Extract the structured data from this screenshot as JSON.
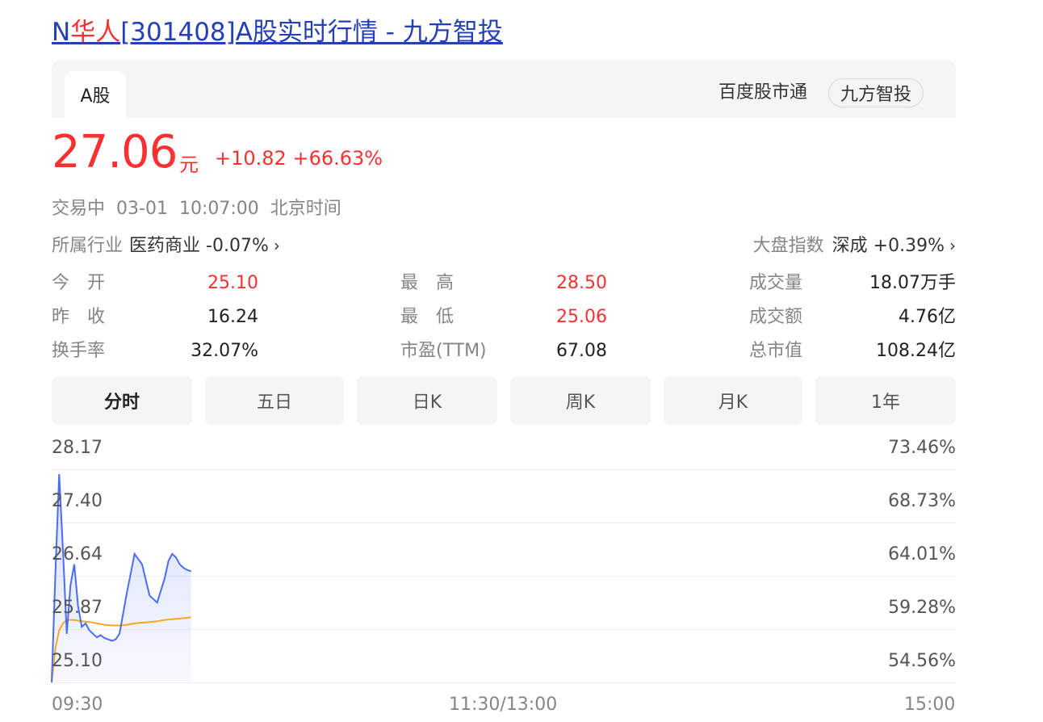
{
  "title": {
    "prefix": "N",
    "highlight": "华人",
    "suffix": "[301408]A股实时行情 - 九方智投"
  },
  "card": {
    "tab_label": "A股",
    "source_label": "百度股市通",
    "source_pill": "九方智投"
  },
  "quote": {
    "price": "27.06",
    "unit": "元",
    "change": "+10.82",
    "change_pct": "+66.63%",
    "status": "交易中",
    "date": "03-01",
    "time": "10:07:00",
    "timezone": "北京时间"
  },
  "industry": {
    "label": "所属行业",
    "name": "医药商业",
    "change": "-0.07%"
  },
  "market_index": {
    "label": "大盘指数",
    "name": "深成",
    "change": "+0.39%"
  },
  "stats": [
    {
      "label": "今　开",
      "value": "25.10",
      "color": "#f73131"
    },
    {
      "label": "最　高",
      "value": "28.50",
      "color": "#f73131"
    },
    {
      "label": "成交量",
      "value": "18.07万手",
      "color": "#222222"
    },
    {
      "label": "昨　收",
      "value": "16.24",
      "color": "#222222"
    },
    {
      "label": "最　低",
      "value": "25.06",
      "color": "#f73131"
    },
    {
      "label": "成交额",
      "value": "4.76亿",
      "color": "#222222"
    },
    {
      "label": "换手率",
      "value": "32.07%",
      "color": "#222222"
    },
    {
      "label": "市盈(TTM)",
      "value": "67.08",
      "color": "#222222"
    },
    {
      "label": "总市值",
      "value": "108.24亿",
      "color": "#222222"
    }
  ],
  "chart_tabs": [
    {
      "label": "分时",
      "active": true
    },
    {
      "label": "五日",
      "active": false
    },
    {
      "label": "日K",
      "active": false
    },
    {
      "label": "周K",
      "active": false
    },
    {
      "label": "月K",
      "active": false
    },
    {
      "label": "1年",
      "active": false
    }
  ],
  "colors": {
    "up": "#f73131",
    "price_line": "#4a6cf7",
    "avg_line": "#f5a623",
    "link": "#2440b3"
  },
  "chart_data": {
    "type": "line",
    "y_ticks_left": [
      "28.17",
      "27.40",
      "26.64",
      "25.87",
      "25.10"
    ],
    "y_ticks_right": [
      "73.46%",
      "68.73%",
      "64.01%",
      "59.28%",
      "54.56%"
    ],
    "x_ticks": [
      "09:30",
      "11:30/13:00",
      "15:00"
    ],
    "ylim": [
      25.1,
      28.17
    ],
    "session_minutes": 240,
    "series": [
      {
        "kind": "price",
        "x": [
          0,
          1,
          2,
          3,
          4,
          5,
          6,
          7,
          8,
          9,
          10,
          11,
          12,
          13,
          14,
          15,
          16,
          17,
          18,
          20,
          22,
          24,
          26,
          28,
          30,
          31,
          32,
          33,
          34,
          35,
          36,
          37
        ],
        "y": [
          25.1,
          26.7,
          28.1,
          27.0,
          25.8,
          26.5,
          26.8,
          26.2,
          25.9,
          25.95,
          25.85,
          25.8,
          25.75,
          25.78,
          25.74,
          25.72,
          25.7,
          25.72,
          25.8,
          26.4,
          26.95,
          26.8,
          26.35,
          26.25,
          26.6,
          26.85,
          26.95,
          26.9,
          26.8,
          26.75,
          26.72,
          26.7
        ]
      },
      {
        "kind": "average",
        "x": [
          0,
          1,
          2,
          3,
          4,
          6,
          8,
          10,
          12,
          14,
          16,
          18,
          20,
          22,
          24,
          26,
          28,
          30,
          32,
          34,
          36,
          37
        ],
        "y": [
          25.1,
          25.6,
          25.85,
          25.95,
          26.0,
          26.0,
          25.98,
          25.97,
          25.95,
          25.93,
          25.92,
          25.92,
          25.93,
          25.95,
          25.96,
          25.97,
          25.98,
          26.0,
          26.01,
          26.02,
          26.03,
          26.04
        ]
      }
    ]
  }
}
